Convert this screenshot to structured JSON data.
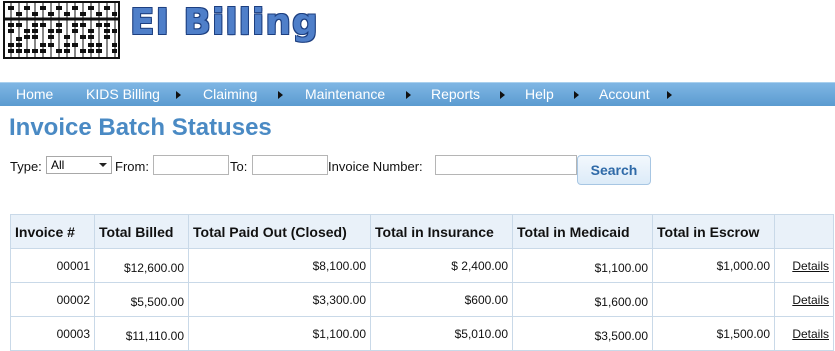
{
  "header": {
    "app_title": "EI Billing",
    "logo_icon": "abacus-icon"
  },
  "nav": [
    {
      "label": "Home",
      "arrow": false
    },
    {
      "label": "KIDS Billing",
      "arrow": true
    },
    {
      "label": "Claiming",
      "arrow": true
    },
    {
      "label": "Maintenance",
      "arrow": true
    },
    {
      "label": "Reports",
      "arrow": true
    },
    {
      "label": "Help",
      "arrow": true
    },
    {
      "label": "Account",
      "arrow": true
    }
  ],
  "page": {
    "title": "Invoice Batch Statuses"
  },
  "filters": {
    "type_label": "Type:",
    "type_value": "All",
    "from_label": "From:",
    "from_value": "",
    "to_label": "To:",
    "to_value": "",
    "invoice_label": "Invoice Number:",
    "invoice_value": "",
    "search_label": "Search"
  },
  "table": {
    "columns": [
      "Invoice #",
      "Total Billed",
      "Total Paid Out (Closed)",
      "Total in Insurance",
      "Total in Medicaid",
      "Total in Escrow",
      ""
    ],
    "rows": [
      {
        "invoice": "00001",
        "billed": "$12,600.00",
        "paid": "$8,100.00",
        "insurance": "$ 2,400.00",
        "medicaid": "$1,100.00",
        "escrow": "$1,000.00",
        "link": "Details"
      },
      {
        "invoice": "00002",
        "billed": "$5,500.00",
        "paid": "$3,300.00",
        "insurance": "$600.00",
        "medicaid": "$1,600.00",
        "escrow": "",
        "link": "Details"
      },
      {
        "invoice": "00003",
        "billed": "$11,110.00",
        "paid": "$1,100.00",
        "insurance": "$5,010.00",
        "medicaid": "$3,500.00",
        "escrow": "$1,500.00",
        "link": "Details"
      }
    ]
  },
  "colors": {
    "nav_bg": "#6ba7da",
    "title_blue": "#4a8ac4",
    "app_title_blue": "#4f7fc9"
  }
}
